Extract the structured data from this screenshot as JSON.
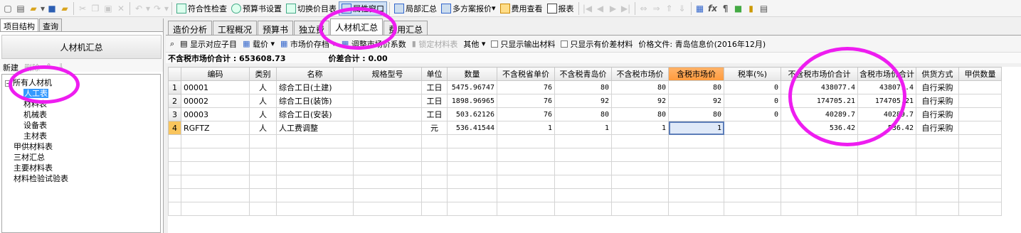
{
  "toolbar": {
    "compliance_check": "符合性检查",
    "budget_settings": "预算书设置",
    "switch_price_table": "切换价目表",
    "properties_window": "属性窗口",
    "partial_summary": "局部汇总",
    "multi_scheme_quote": "多方案报价",
    "fee_view": "费用查看",
    "report": "报表"
  },
  "left_panel": {
    "tabs": [
      "项目结构",
      "查询"
    ],
    "title": "人材机汇总",
    "new_label": "新建",
    "delete_label": "删除",
    "tree": [
      {
        "label": "所有人材机",
        "level": 0,
        "expanded": true
      },
      {
        "label": "人工表",
        "level": 1,
        "selected": true
      },
      {
        "label": "材料表",
        "level": 1
      },
      {
        "label": "机械表",
        "level": 1
      },
      {
        "label": "设备表",
        "level": 1
      },
      {
        "label": "主材表",
        "level": 1
      },
      {
        "label": "甲供材料表",
        "level": 0
      },
      {
        "label": "三材汇总",
        "level": 0
      },
      {
        "label": "主要材料表",
        "level": 0
      },
      {
        "label": "材料检验试验表",
        "level": 0
      }
    ]
  },
  "tabs": [
    "造价分析",
    "工程概况",
    "预算书",
    "独立费",
    "人材机汇总",
    "费用汇总"
  ],
  "active_tab_index": 4,
  "subtoolbar": {
    "show_sub_items": "显示对应子目",
    "load_price": "载价",
    "market_price_file": "市场价存档",
    "adjust_coeff": "调整市场价系数",
    "lock_material": "锁定材料表",
    "other": "其他",
    "only_output_materials": "只显示输出材料",
    "only_price_diff": "只显示有价差材料",
    "price_file": "价格文件: 青岛信息价(2016年12月)"
  },
  "summary": {
    "market_total": "不含税市场价合计 : 653608.73",
    "price_diff_total": "价差合计 : 0.00"
  },
  "table": {
    "columns": [
      "",
      "编码",
      "类别",
      "名称",
      "规格型号",
      "单位",
      "数量",
      "不含税省单价",
      "不含税青岛价",
      "不含税市场价",
      "含税市场价",
      "税率(%)",
      "不含税市场价合计",
      "含税市场价合计",
      "供货方式",
      "甲供数量"
    ],
    "highlighted_column": 10,
    "rows": [
      {
        "no": "1",
        "code": "00001",
        "category": "人",
        "name": "综合工日(土建)",
        "spec": "",
        "unit": "工日",
        "qty": "5475.96747",
        "prov_price": "76",
        "qd_price": "80",
        "market_price": "80",
        "tax_market_price": "80",
        "tax_rate": "0",
        "market_total": "438077.4",
        "tax_market_total": "438077.4",
        "supply": "自行采购",
        "a_supply_qty": ""
      },
      {
        "no": "2",
        "code": "00002",
        "category": "人",
        "name": "综合工日(装饰)",
        "spec": "",
        "unit": "工日",
        "qty": "1898.96965",
        "prov_price": "76",
        "qd_price": "92",
        "market_price": "92",
        "tax_market_price": "92",
        "tax_rate": "0",
        "market_total": "174705.21",
        "tax_market_total": "174705.21",
        "supply": "自行采购",
        "a_supply_qty": ""
      },
      {
        "no": "3",
        "code": "00003",
        "category": "人",
        "name": "综合工日(安装)",
        "spec": "",
        "unit": "工日",
        "qty": "503.62126",
        "prov_price": "76",
        "qd_price": "80",
        "market_price": "80",
        "tax_market_price": "80",
        "tax_rate": "0",
        "market_total": "40289.7",
        "tax_market_total": "40289.7",
        "supply": "自行采购",
        "a_supply_qty": ""
      },
      {
        "no": "4",
        "code": "RGFTZ",
        "category": "人",
        "name": "人工费调整",
        "spec": "",
        "unit": "元",
        "qty": "536.41544",
        "prov_price": "1",
        "qd_price": "1",
        "market_price": "1",
        "tax_market_price": "1",
        "tax_rate": "",
        "market_total": "536.42",
        "tax_market_total": "536.42",
        "supply": "自行采购",
        "a_supply_qty": ""
      }
    ]
  },
  "colors": {
    "annotation": "#ee1df0",
    "highlight_header": "#ff9a3c",
    "selection": "#3399ff"
  }
}
